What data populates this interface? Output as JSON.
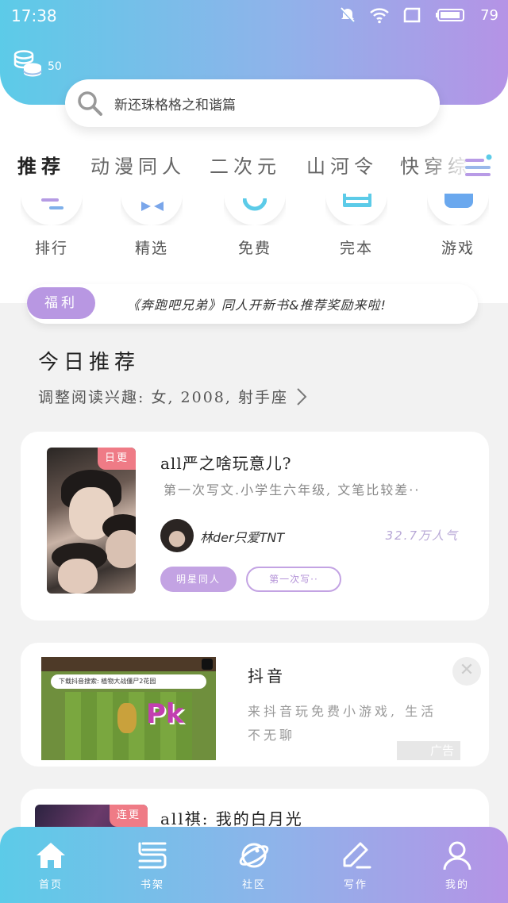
{
  "status_bar": {
    "time": "17:38",
    "battery": "79"
  },
  "header": {
    "coin_count": "50",
    "search_placeholder": "新还珠格格之和谐篇"
  },
  "tabs": [
    {
      "label": "推荐",
      "active": true
    },
    {
      "label": "动漫同人",
      "active": false
    },
    {
      "label": "二次元",
      "active": false
    },
    {
      "label": "山河令",
      "active": false
    },
    {
      "label": "快穿综",
      "active": false
    }
  ],
  "quick_entries": [
    {
      "label": "排行",
      "icon": "ranking-icon"
    },
    {
      "label": "精选",
      "icon": "bow-icon"
    },
    {
      "label": "免费",
      "icon": "free-icon"
    },
    {
      "label": "完本",
      "icon": "book-complete-icon"
    },
    {
      "label": "游戏",
      "icon": "game-icon"
    }
  ],
  "notice": {
    "tag": "福利",
    "text": "《奔跑吧兄弟》同人开新书&推荐奖励来啦!"
  },
  "recommend": {
    "title": "今日推荐",
    "subtitle": "调整阅读兴趣: 女, 2008, 射手座"
  },
  "books": [
    {
      "badge": "日更",
      "title": "all严之啥玩意儿?",
      "description": "第一次写文.小学生六年级, 文笔比较差··",
      "author": "林der只爱TNT",
      "popularity": "32.7万人气",
      "tags": [
        "明星同人",
        "第一次写··"
      ]
    },
    {
      "badge": "连更",
      "title": "all祺: 我的白月光"
    }
  ],
  "ad": {
    "title": "抖音",
    "description": "来抖音玩免费小游戏, 生活不无聊",
    "label": "广告",
    "image_search_text": "下载抖音搜索: 植物大战僵尸2花园",
    "image_badge": "Pk"
  },
  "bottom_nav": [
    {
      "label": "首页",
      "icon": "home-icon"
    },
    {
      "label": "书架",
      "icon": "bookshelf-icon"
    },
    {
      "label": "社区",
      "icon": "planet-icon"
    },
    {
      "label": "写作",
      "icon": "pen-icon"
    },
    {
      "label": "我的",
      "icon": "profile-icon"
    }
  ],
  "colors": {
    "gradient_start": "#5ccbe8",
    "gradient_end": "#b593e6",
    "accent": "#b897e2",
    "badge_red": "#ef7b86"
  }
}
